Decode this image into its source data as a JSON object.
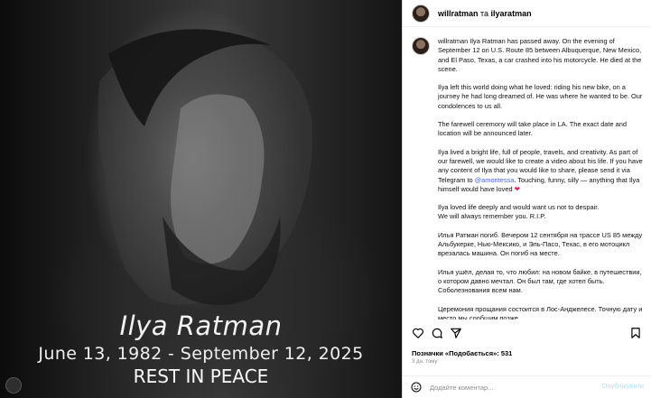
{
  "header": {
    "user1": "willratman",
    "separator": " та ",
    "user2": "ilyaratman"
  },
  "media": {
    "name": "Ilya Ratman",
    "dates": "June 13, 1982 - September 12, 2025",
    "rip": "REST IN PEACE"
  },
  "caption": {
    "username": "willratman",
    "p1": " Ilya Ratman has passed away. On the evening of September 12 on U.S. Route 85 between Albuquerque, New Mexico, and El Paso, Texas, a car crashed into his motorcycle. He died at the scene.",
    "p2": "Ilya left this world doing what he loved: riding his new bike, on a journey he had long dreamed of. He was where he wanted to be. Our condolences to us all.",
    "p3": "The farewell ceremony will take place in LA. The exact date and location will be announced later.",
    "p4_before": "Ilya lived a bright life, full of people, travels, and creativity. As part of our farewell, we would like to create a video about his life. If you have any content of Ilya that you would like to share, please send it via Telegram to ",
    "p4_mention": "@amontessa",
    "p4_after": ". Touching, funny, silly — anything that Ilya himself would have loved ",
    "p4_emoji": "❤",
    "p5a": "Ilya loved life deeply and would want us not to despair.",
    "p5b": "We will always remember you. R.I.P.",
    "p6": "Илья Ратман погиб. Вечером 12 сентября на трассе US 85 между Альбукерке, Нью-Мексико, и Эль-Пасо, Техас, в его мотоцикл врезалась машина. Он погиб на месте.",
    "p7": "Илья ушёл, делая то, что любил: на новом байке, в путешествии, о котором давно мечтал. Он был там, где хотел быть. Соболезнования всем нам.",
    "p8": "Церемония прощания состоится в Лос-Анджелесе. Точную дату и место мы сообщим позже."
  },
  "engagement": {
    "likes": "Позначки «Подобається»: 531",
    "time": "3 дн. тому"
  },
  "composer": {
    "placeholder": "Додайте коментар...",
    "post_label": "Опублікувати"
  },
  "icons": [
    "heart-icon",
    "comment-icon",
    "share-icon",
    "bookmark-icon",
    "emoji-icon"
  ]
}
